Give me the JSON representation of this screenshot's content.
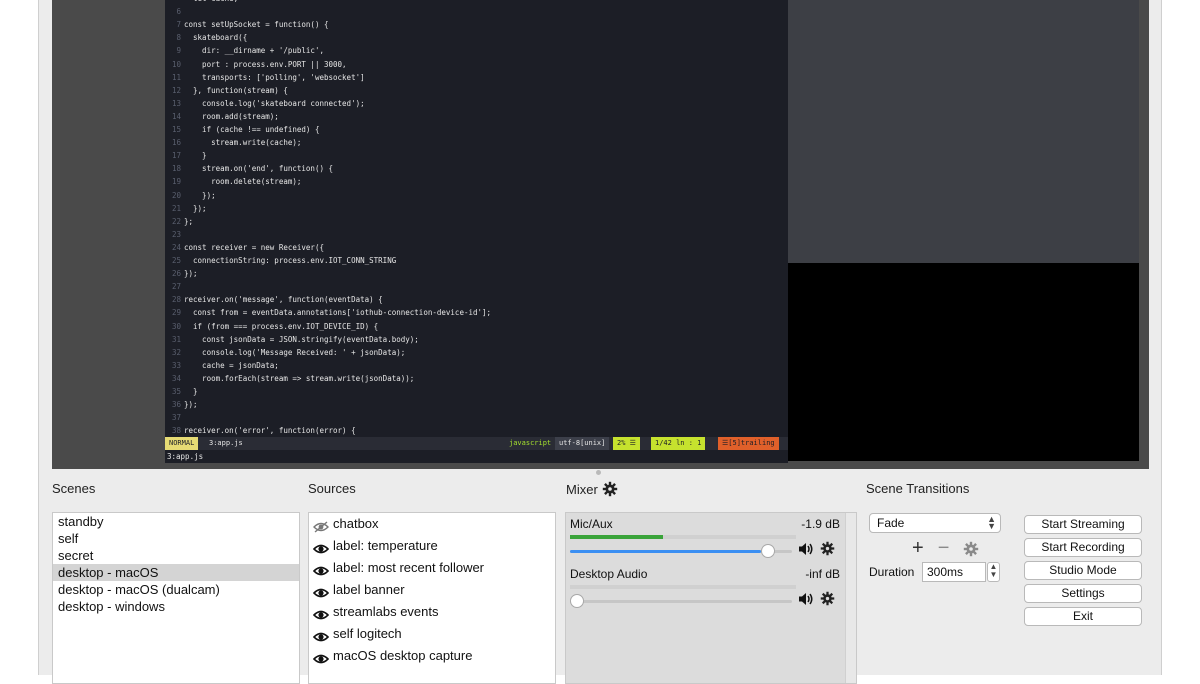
{
  "preview": {
    "code_lines": [
      {
        "n": "",
        "t": "  let cache;"
      },
      {
        "n": "6",
        "t": ""
      },
      {
        "n": "7",
        "t": "const setUpSocket = function() {"
      },
      {
        "n": "8",
        "t": "  skateboard({"
      },
      {
        "n": "9",
        "t": "    dir: __dirname + '/public',"
      },
      {
        "n": "10",
        "t": "    port : process.env.PORT || 3000,"
      },
      {
        "n": "11",
        "t": "    transports: ['polling', 'websocket']"
      },
      {
        "n": "12",
        "t": "  }, function(stream) {"
      },
      {
        "n": "13",
        "t": "    console.log('skateboard connected');"
      },
      {
        "n": "14",
        "t": "    room.add(stream);"
      },
      {
        "n": "15",
        "t": "    if (cache !== undefined) {"
      },
      {
        "n": "16",
        "t": "      stream.write(cache);"
      },
      {
        "n": "17",
        "t": "    }"
      },
      {
        "n": "18",
        "t": "    stream.on('end', function() {"
      },
      {
        "n": "19",
        "t": "      room.delete(stream);"
      },
      {
        "n": "20",
        "t": "    });"
      },
      {
        "n": "21",
        "t": "  });"
      },
      {
        "n": "22",
        "t": "};"
      },
      {
        "n": "23",
        "t": ""
      },
      {
        "n": "24",
        "t": "const receiver = new Receiver({"
      },
      {
        "n": "25",
        "t": "  connectionString: process.env.IOT_CONN_STRING"
      },
      {
        "n": "26",
        "t": "});"
      },
      {
        "n": "27",
        "t": ""
      },
      {
        "n": "28",
        "t": "receiver.on('message', function(eventData) {"
      },
      {
        "n": "29",
        "t": "  const from = eventData.annotations['iothub-connection-device-id'];"
      },
      {
        "n": "30",
        "t": "  if (from === process.env.IOT_DEVICE_ID) {"
      },
      {
        "n": "31",
        "t": "    const jsonData = JSON.stringify(eventData.body);"
      },
      {
        "n": "32",
        "t": "    console.log('Message Received: ' + jsonData);"
      },
      {
        "n": "33",
        "t": "    cache = jsonData;"
      },
      {
        "n": "34",
        "t": "    room.forEach(stream => stream.write(jsonData));"
      },
      {
        "n": "35",
        "t": "  }"
      },
      {
        "n": "36",
        "t": "});"
      },
      {
        "n": "37",
        "t": ""
      },
      {
        "n": "38",
        "t": "receiver.on('error', function(error) {"
      }
    ],
    "status": {
      "mode": "NORMAL",
      "file": "3:app.js",
      "filetype": "javascript",
      "encoding": "utf-8[unix]",
      "percent": "2% ☰",
      "position": "1/42 ln :  1",
      "warning": "☰[5]trailing"
    },
    "cmdline": "3:app.js"
  },
  "scenes": {
    "title": "Scenes",
    "items": [
      "standby",
      "self",
      "secret",
      "desktop - macOS",
      "desktop - macOS (dualcam)",
      "desktop - windows"
    ],
    "selected_index": 3
  },
  "sources": {
    "title": "Sources",
    "items": [
      {
        "label": "chatbox",
        "visible": false
      },
      {
        "label": "label: temperature",
        "visible": true
      },
      {
        "label": "label: most recent follower",
        "visible": true
      },
      {
        "label": "label banner",
        "visible": true
      },
      {
        "label": "streamlabs events",
        "visible": true
      },
      {
        "label": "self logitech",
        "visible": true
      },
      {
        "label": "macOS desktop capture",
        "visible": true
      }
    ]
  },
  "mixer": {
    "title": "Mixer",
    "channels": [
      {
        "name": "Mic/Aux",
        "db": "-1.9 dB",
        "level_fraction": 0.41,
        "volume_fraction": 0.92
      },
      {
        "name": "Desktop Audio",
        "db": "-inf dB",
        "level_fraction": 0,
        "volume_fraction": 0.0
      }
    ]
  },
  "transitions": {
    "title": "Scene Transitions",
    "selected": "Fade",
    "add": "+",
    "remove": "−",
    "duration_label": "Duration",
    "duration_value": "300ms"
  },
  "controls": {
    "start_streaming": "Start Streaming",
    "start_recording": "Start Recording",
    "studio_mode": "Studio Mode",
    "settings": "Settings",
    "exit": "Exit"
  },
  "colors": {
    "accent": "#3b8ff2",
    "meter": "#3aa43a",
    "mode_bg": "#e6db74",
    "warning_bg": "#e0602a"
  }
}
